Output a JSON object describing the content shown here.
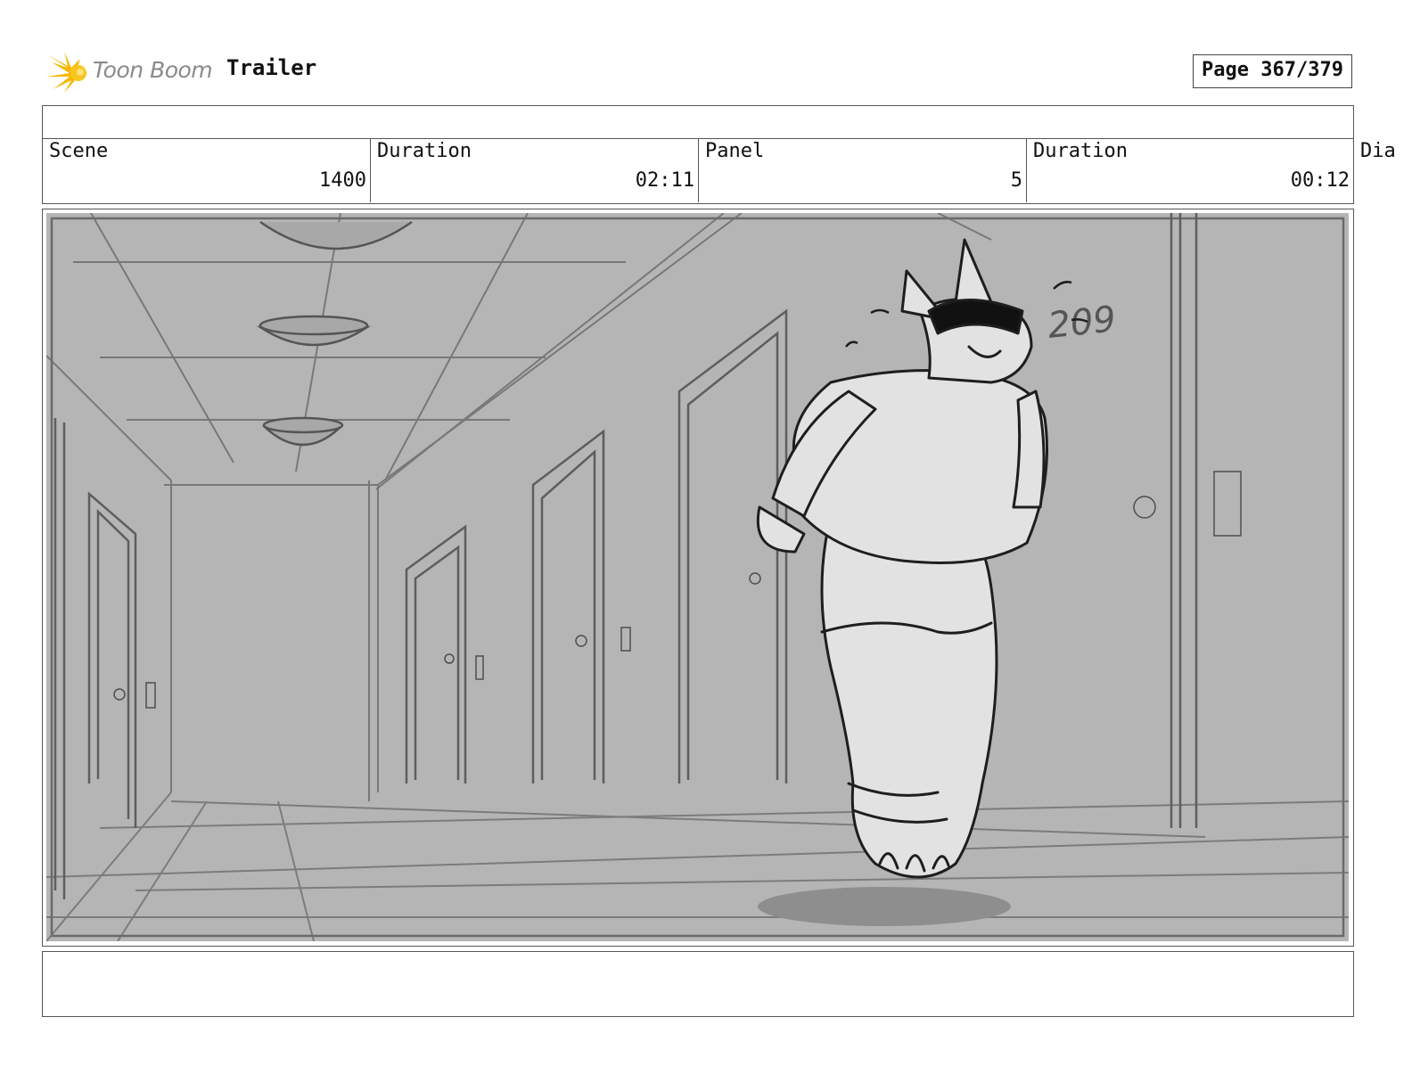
{
  "header": {
    "logo_text": "Toon Boom",
    "project_title": "Trailer",
    "page_label": "Page 367/379"
  },
  "info": {
    "scene_label": "Scene",
    "scene_value": "1400",
    "scene_duration_label": "Duration",
    "scene_duration_value": "02:11",
    "panel_label": "Panel",
    "panel_value": "5",
    "panel_duration_label": "Duration",
    "panel_duration_value": "00:12",
    "dialogue_label": "Dia"
  },
  "panel": {
    "image_description_icon": "storyboard-sketch-hallway-character",
    "door_number_text": "209"
  },
  "colors": {
    "logo_yellow": "#f5b800",
    "logo_gray": "#8a8a8a",
    "sketch_bg": "#b5b5b5",
    "character_fill": "#e2e2e2"
  }
}
